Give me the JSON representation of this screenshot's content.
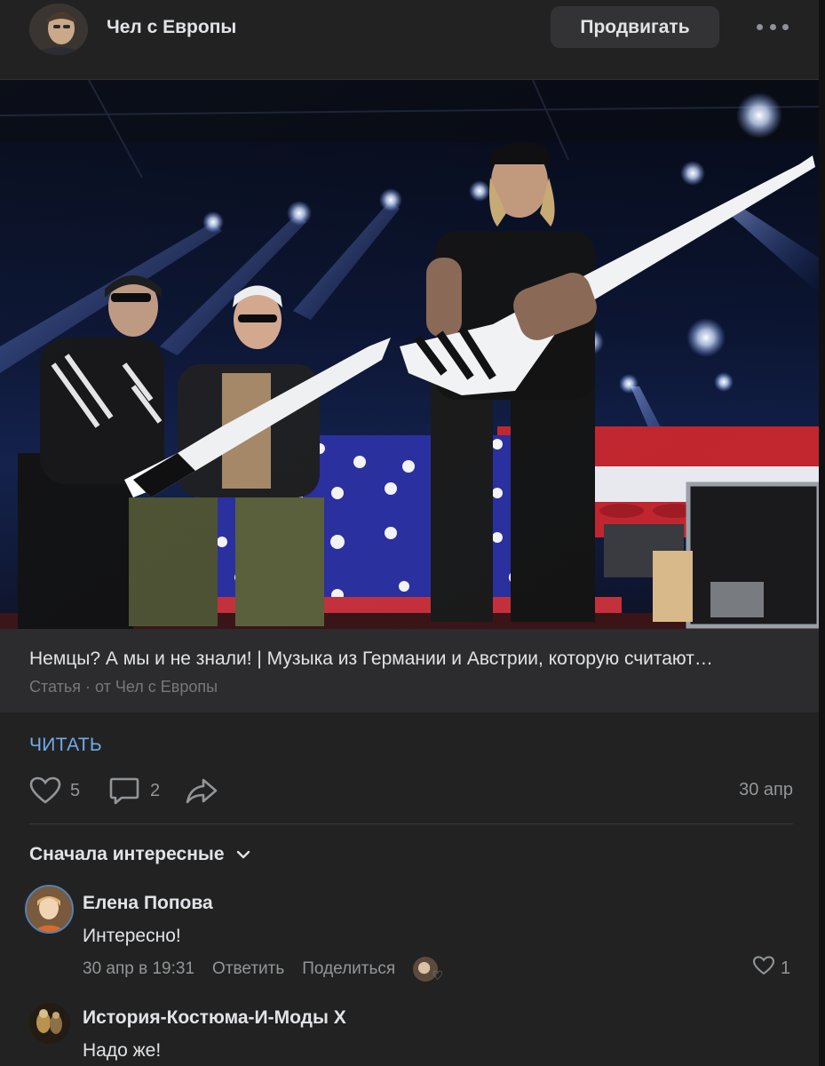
{
  "post": {
    "author": "Чел с Европы",
    "promote_label": "Продвигать",
    "date": "30 апр"
  },
  "article": {
    "title": "Немцы? А мы и не знали! | Музыка из Германии и Австрии, которую считают…",
    "meta": "Статья · от Чел с Европы",
    "read_label": "ЧИТАТЬ"
  },
  "actions": {
    "likes": "5",
    "comments": "2"
  },
  "comments_sort": "Сначала интересные",
  "comments": [
    {
      "author": "Елена Попова",
      "text": "Интересно!",
      "date": "30 апр в 19:31",
      "reply_label": "Ответить",
      "share_label": "Поделиться",
      "likes": "1"
    },
    {
      "author": "История-Костюма-И-Моды X",
      "text": "Надо же!"
    }
  ],
  "colors": {
    "background": "#222222",
    "accent_link": "#71aaeb",
    "secondary_text": "#939699",
    "button_bg": "#333335"
  }
}
